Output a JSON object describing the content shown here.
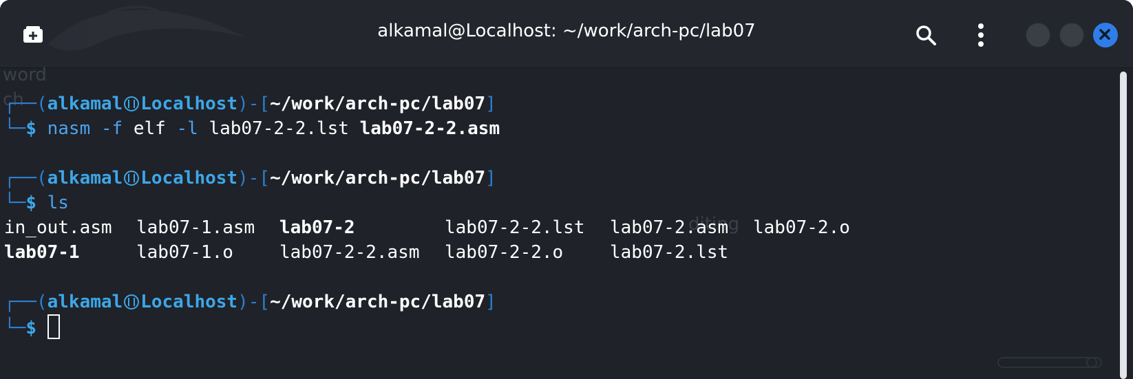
{
  "window": {
    "title": "alkamal@Localhost: ~/work/arch-pc/lab07",
    "icons": {
      "new_tab": "new-tab-icon",
      "search": "search-icon",
      "menu": "kebab-menu-icon",
      "minimize": "minimize-icon",
      "maximize": "maximize-icon",
      "close": "close-icon"
    }
  },
  "colors": {
    "background": "#1f2229",
    "titlebar": "#23262d",
    "prompt_box": "#2c7fd0",
    "prompt_user": "#3da7e8",
    "command": "#4aa3ef",
    "executable": "#37c6a5",
    "close_button": "#2f7de8"
  },
  "terminal": {
    "ghost_text": [
      "word",
      "ch"
    ],
    "ghost_text_right": "diting",
    "prompt": {
      "top_left": "┌──(",
      "user": "alkamal",
      "host": "Localhost",
      "mid": ")-[",
      "path": "~/work/arch-pc/lab07",
      "end": "]",
      "bottom_left": "└─",
      "dollar": "$"
    },
    "commands": [
      {
        "cmd": "nasm",
        "args_opt": "-f",
        "args_plain": "elf",
        "args_opt2": "-l",
        "args_plain2": "lab07-2-2.lst",
        "args_bold": "lab07-2-2.asm"
      },
      {
        "cmd": "ls"
      }
    ],
    "ls_output": {
      "row1": [
        "in_out.asm",
        "lab07-1.asm",
        "lab07-2",
        "lab07-2-2.lst",
        "lab07-2.asm",
        "lab07-2.o"
      ],
      "row2": [
        "lab07-1",
        "lab07-1.o",
        "lab07-2-2.asm",
        "lab07-2-2.o",
        "lab07-2.lst"
      ]
    }
  }
}
